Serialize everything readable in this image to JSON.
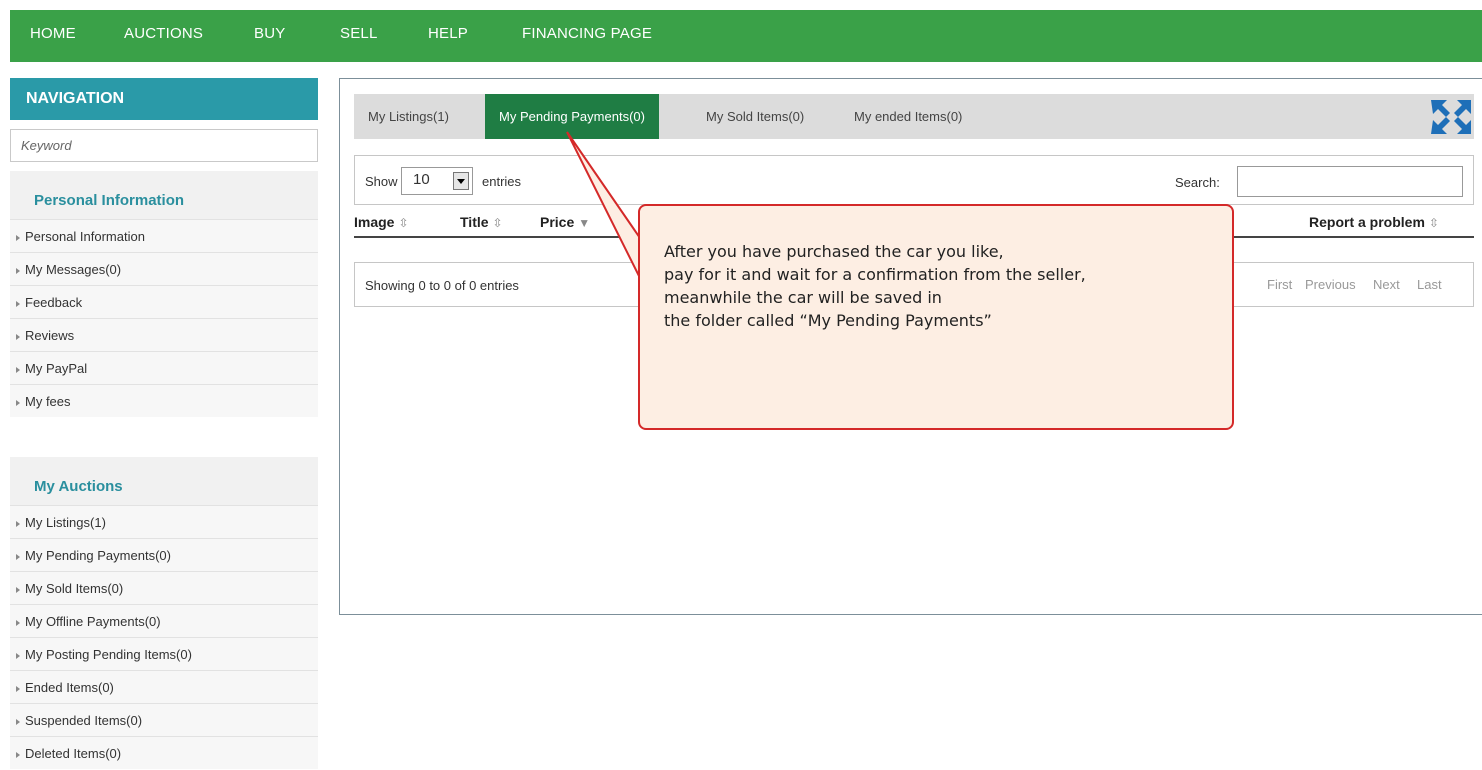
{
  "topnav": {
    "items": [
      "HOME",
      "AUCTIONS",
      "BUY",
      "SELL",
      "HELP",
      "FINANCING PAGE"
    ]
  },
  "sidebar": {
    "header": "NAVIGATION",
    "keyword_placeholder": "Keyword",
    "personal": {
      "title": "Personal Information",
      "items": [
        "Personal Information",
        "My Messages(0)",
        "Feedback",
        "Reviews",
        "My PayPal",
        "My fees"
      ]
    },
    "auctions": {
      "title": "My Auctions",
      "items": [
        "My Listings(1)",
        "My Pending Payments(0)",
        "My Sold Items(0)",
        "My Offline Payments(0)",
        "My Posting Pending Items(0)",
        "Ended Items(0)",
        "Suspended Items(0)",
        "Deleted Items(0)"
      ]
    }
  },
  "tabs": [
    "My Listings(1)",
    "My Pending Payments(0)",
    "My Sold Items(0)",
    "My ended Items(0)"
  ],
  "active_tab": "My Pending Payments(0)",
  "table": {
    "show_label": "Show",
    "page_size": "10",
    "entries_label": "entries",
    "search_label": "Search:",
    "columns": [
      "Image",
      "Title",
      "Price",
      "Report a problem"
    ],
    "info": "Showing 0 to 0 of 0 entries",
    "pager": [
      "First",
      "Previous",
      "Next",
      "Last"
    ]
  },
  "callout": {
    "lines": [
      "After you have purchased the car you like,",
      "pay for it and wait for a confirmation from the seller,",
      "meanwhile the car will be saved in",
      "the folder called “My Pending Payments”"
    ]
  },
  "colors": {
    "topnav_bg": "#3aa148",
    "nav_header_bg": "#2a9aa8",
    "active_tab_bg": "#1f7d44",
    "callout_border": "#d42929",
    "callout_bg": "#fdeee3",
    "expand_icon": "#1e6fb8"
  }
}
